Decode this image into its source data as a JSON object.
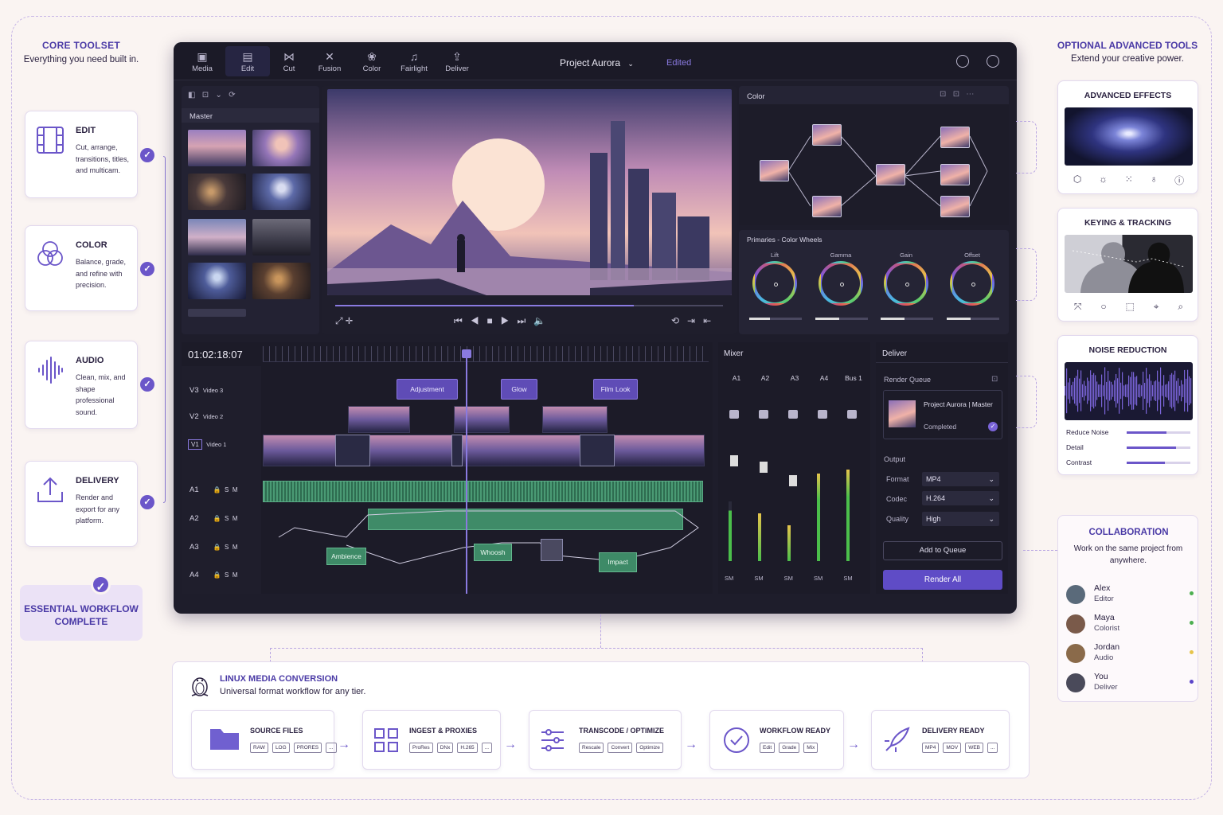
{
  "left": {
    "title": "CORE TOOLSET",
    "subtitle": "Everything you need built in.",
    "cards": [
      {
        "title": "EDIT",
        "desc": "Cut, arrange, transitions, titles, and multicam.",
        "icon": "film-strip-icon"
      },
      {
        "title": "COLOR",
        "desc": "Balance, grade, and refine with precision.",
        "icon": "color-circles-icon"
      },
      {
        "title": "AUDIO",
        "desc": "Clean, mix, and shape professional sound.",
        "icon": "waveform-icon"
      },
      {
        "title": "DELIVERY",
        "desc": "Render and export for any platform.",
        "icon": "upload-icon"
      }
    ],
    "complete": "ESSENTIAL WORKFLOW COMPLETE"
  },
  "app": {
    "pages": [
      "Media",
      "Edit",
      "Cut",
      "Fusion",
      "Color",
      "Fairlight",
      "Deliver"
    ],
    "active_page": "Edit",
    "project": "Project Aurora",
    "status": "Edited",
    "media_pool": {
      "bin": "Master"
    },
    "color": {
      "title": "Color",
      "wheels_title": "Primaries - Color Wheels",
      "wheels": [
        "Lift",
        "Gamma",
        "Gain",
        "Offset"
      ]
    },
    "timeline": {
      "timecode": "01:02:18:07",
      "tracks": [
        {
          "id": "V3",
          "name": "Video 3"
        },
        {
          "id": "V2",
          "name": "Video 2"
        },
        {
          "id": "V1",
          "name": "Video 1"
        }
      ],
      "audio_tracks": [
        "A1",
        "A2",
        "A3",
        "A4"
      ],
      "solo": "S",
      "mute": "M",
      "fx": [
        "Adjustment",
        "Glow",
        "Film Look"
      ],
      "audio_clips": [
        "Ambience",
        "Whoosh",
        "Impact"
      ],
      "playhead_progress": 0.77
    },
    "mixer": {
      "title": "Mixer",
      "channels": [
        "A1",
        "A2",
        "A3",
        "A4",
        "Bus 1"
      ]
    },
    "deliver": {
      "title": "Deliver",
      "queue_label": "Render Queue",
      "job": "Project Aurora | Master",
      "job_status": "Completed",
      "output_label": "Output",
      "fields": [
        {
          "label": "Format",
          "value": "MP4"
        },
        {
          "label": "Codec",
          "value": "H.264"
        },
        {
          "label": "Quality",
          "value": "High"
        }
      ],
      "add_btn": "Add to Queue",
      "render_btn": "Render All"
    }
  },
  "right": {
    "title": "OPTIONAL ADVANCED TOOLS",
    "subtitle": "Extend your creative power.",
    "effects": "ADVANCED EFFECTS",
    "keying": "KEYING & TRACKING",
    "noise": "NOISE REDUCTION",
    "noise_params": [
      {
        "label": "Reduce Noise",
        "value": 0.62
      },
      {
        "label": "Detail",
        "value": 0.78
      },
      {
        "label": "Contrast",
        "value": 0.6
      }
    ],
    "collab": {
      "title": "COLLABORATION",
      "subtitle": "Work on the same project from anywhere.",
      "people": [
        {
          "name": "Alex",
          "role": "Editor",
          "color": "#4caf50"
        },
        {
          "name": "Maya",
          "role": "Colorist",
          "color": "#4caf50"
        },
        {
          "name": "Jordan",
          "role": "Audio",
          "color": "#e6c54c"
        },
        {
          "name": "You",
          "role": "Deliver",
          "color": "#5b45c9"
        }
      ]
    }
  },
  "bottom": {
    "title": "LINUX MEDIA CONVERSION",
    "subtitle": "Universal format workflow for any tier.",
    "steps": [
      {
        "title": "SOURCE FILES",
        "chips": [
          "RAW",
          "LOG",
          "PRORES",
          "..."
        ]
      },
      {
        "title": "INGEST & PROXIES",
        "chips": [
          "ProRes",
          "DNx",
          "H.265",
          "..."
        ]
      },
      {
        "title": "TRANSCODE / OPTIMIZE",
        "chips": [
          "Rescale",
          "Convert",
          "Optimize"
        ]
      },
      {
        "title": "WORKFLOW READY",
        "chips": [
          "Edit",
          "Grade",
          "Mix"
        ]
      },
      {
        "title": "DELIVERY READY",
        "chips": [
          "MP4",
          "MOV",
          "WEB",
          "..."
        ]
      }
    ]
  }
}
